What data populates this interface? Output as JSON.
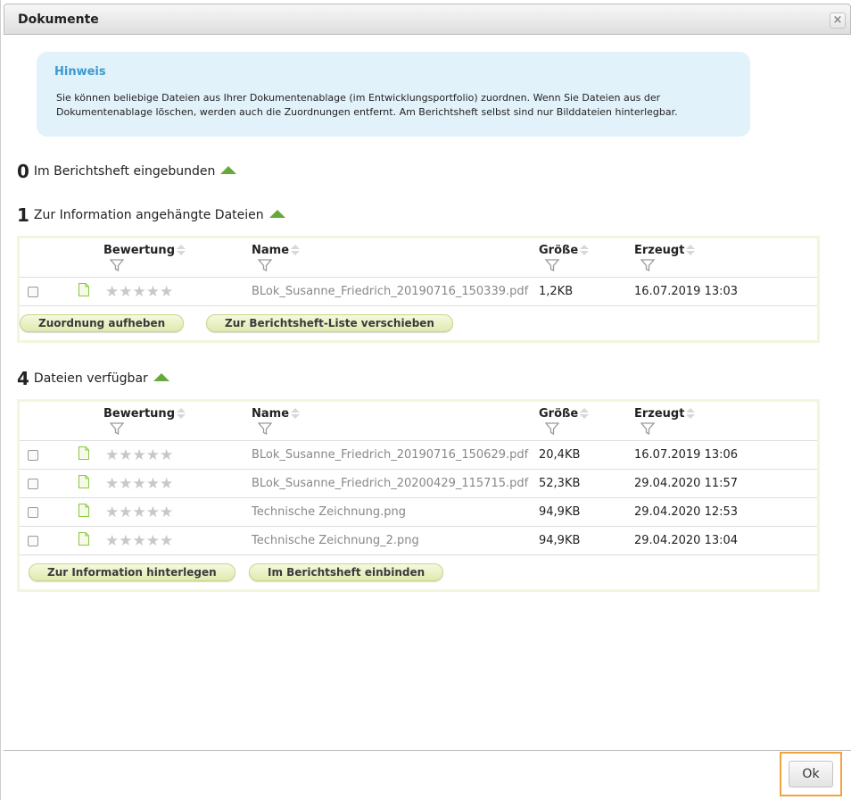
{
  "dialog": {
    "title": "Dokumente",
    "close_glyph": "×"
  },
  "hint": {
    "title": "Hinweis",
    "text": "Sie können beliebige Dateien aus Ihrer Dokumentenablage (im Entwicklungsportfolio) zuordnen. Wenn Sie Dateien aus der Dokumentenablage löschen, werden auch die Zuordnungen entfernt. Am Berichtsheft selbst sind nur Bilddateien hinterlegbar."
  },
  "columns": {
    "rating": "Bewertung",
    "name": "Name",
    "size": "Größe",
    "created": "Erzeugt"
  },
  "sections": {
    "embedded": {
      "count": "0",
      "label": "Im Berichtsheft eingebunden"
    },
    "info": {
      "count": "1",
      "label": "Zur Information angehängte Dateien",
      "rows": [
        {
          "name": "BLok_Susanne_Friedrich_20190716_150339.pdf",
          "size": "1,2KB",
          "created": "16.07.2019 13:03"
        }
      ],
      "buttons": {
        "unassign": "Zuordnung aufheben",
        "move": "Zur Berichtsheft-Liste verschieben"
      }
    },
    "available": {
      "count": "4",
      "label": "Dateien verfügbar",
      "rows": [
        {
          "name": "BLok_Susanne_Friedrich_20190716_150629.pdf",
          "size": "20,4KB",
          "created": "16.07.2019 13:06"
        },
        {
          "name": "BLok_Susanne_Friedrich_20200429_115715.pdf",
          "size": "52,3KB",
          "created": "29.04.2020 11:57"
        },
        {
          "name": "Technische Zeichnung.png",
          "size": "94,9KB",
          "created": "29.04.2020 12:53"
        },
        {
          "name": "Technische Zeichnung_2.png",
          "size": "94,9KB",
          "created": "29.04.2020 13:04"
        }
      ],
      "buttons": {
        "to_info": "Zur Information hinterlegen",
        "embed": "Im Berichtsheft einbinden"
      }
    }
  },
  "rating_stars": "★★★★★",
  "footer": {
    "ok_label": "Ok"
  },
  "colors": {
    "accent_green": "#66a83a",
    "hint_bg": "#e2f2fb",
    "hint_title": "#3a9ad2",
    "highlight": "#f0a43c"
  }
}
